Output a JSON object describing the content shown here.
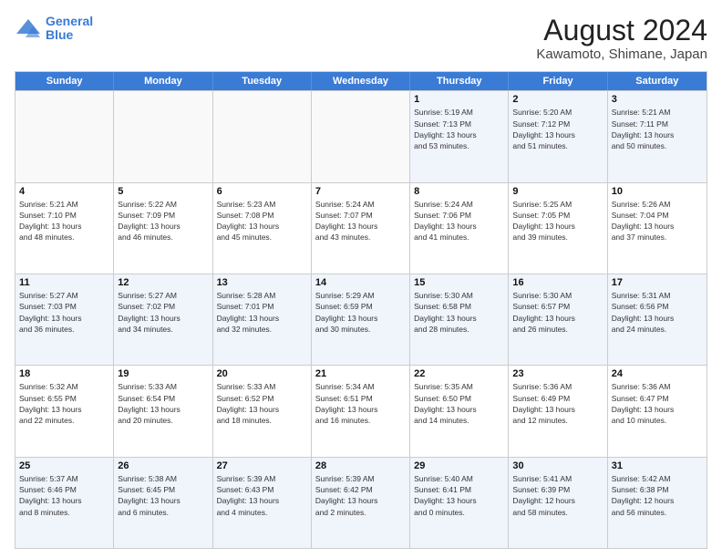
{
  "header": {
    "logo_line1": "General",
    "logo_line2": "Blue",
    "title": "August 2024",
    "subtitle": "Kawamoto, Shimane, Japan"
  },
  "weekdays": [
    "Sunday",
    "Monday",
    "Tuesday",
    "Wednesday",
    "Thursday",
    "Friday",
    "Saturday"
  ],
  "rows": [
    [
      {
        "day": "",
        "info": "",
        "empty": true
      },
      {
        "day": "",
        "info": "",
        "empty": true
      },
      {
        "day": "",
        "info": "",
        "empty": true
      },
      {
        "day": "",
        "info": "",
        "empty": true
      },
      {
        "day": "1",
        "info": "Sunrise: 5:19 AM\nSunset: 7:13 PM\nDaylight: 13 hours\nand 53 minutes."
      },
      {
        "day": "2",
        "info": "Sunrise: 5:20 AM\nSunset: 7:12 PM\nDaylight: 13 hours\nand 51 minutes."
      },
      {
        "day": "3",
        "info": "Sunrise: 5:21 AM\nSunset: 7:11 PM\nDaylight: 13 hours\nand 50 minutes."
      }
    ],
    [
      {
        "day": "4",
        "info": "Sunrise: 5:21 AM\nSunset: 7:10 PM\nDaylight: 13 hours\nand 48 minutes."
      },
      {
        "day": "5",
        "info": "Sunrise: 5:22 AM\nSunset: 7:09 PM\nDaylight: 13 hours\nand 46 minutes."
      },
      {
        "day": "6",
        "info": "Sunrise: 5:23 AM\nSunset: 7:08 PM\nDaylight: 13 hours\nand 45 minutes."
      },
      {
        "day": "7",
        "info": "Sunrise: 5:24 AM\nSunset: 7:07 PM\nDaylight: 13 hours\nand 43 minutes."
      },
      {
        "day": "8",
        "info": "Sunrise: 5:24 AM\nSunset: 7:06 PM\nDaylight: 13 hours\nand 41 minutes."
      },
      {
        "day": "9",
        "info": "Sunrise: 5:25 AM\nSunset: 7:05 PM\nDaylight: 13 hours\nand 39 minutes."
      },
      {
        "day": "10",
        "info": "Sunrise: 5:26 AM\nSunset: 7:04 PM\nDaylight: 13 hours\nand 37 minutes."
      }
    ],
    [
      {
        "day": "11",
        "info": "Sunrise: 5:27 AM\nSunset: 7:03 PM\nDaylight: 13 hours\nand 36 minutes."
      },
      {
        "day": "12",
        "info": "Sunrise: 5:27 AM\nSunset: 7:02 PM\nDaylight: 13 hours\nand 34 minutes."
      },
      {
        "day": "13",
        "info": "Sunrise: 5:28 AM\nSunset: 7:01 PM\nDaylight: 13 hours\nand 32 minutes."
      },
      {
        "day": "14",
        "info": "Sunrise: 5:29 AM\nSunset: 6:59 PM\nDaylight: 13 hours\nand 30 minutes."
      },
      {
        "day": "15",
        "info": "Sunrise: 5:30 AM\nSunset: 6:58 PM\nDaylight: 13 hours\nand 28 minutes."
      },
      {
        "day": "16",
        "info": "Sunrise: 5:30 AM\nSunset: 6:57 PM\nDaylight: 13 hours\nand 26 minutes."
      },
      {
        "day": "17",
        "info": "Sunrise: 5:31 AM\nSunset: 6:56 PM\nDaylight: 13 hours\nand 24 minutes."
      }
    ],
    [
      {
        "day": "18",
        "info": "Sunrise: 5:32 AM\nSunset: 6:55 PM\nDaylight: 13 hours\nand 22 minutes."
      },
      {
        "day": "19",
        "info": "Sunrise: 5:33 AM\nSunset: 6:54 PM\nDaylight: 13 hours\nand 20 minutes."
      },
      {
        "day": "20",
        "info": "Sunrise: 5:33 AM\nSunset: 6:52 PM\nDaylight: 13 hours\nand 18 minutes."
      },
      {
        "day": "21",
        "info": "Sunrise: 5:34 AM\nSunset: 6:51 PM\nDaylight: 13 hours\nand 16 minutes."
      },
      {
        "day": "22",
        "info": "Sunrise: 5:35 AM\nSunset: 6:50 PM\nDaylight: 13 hours\nand 14 minutes."
      },
      {
        "day": "23",
        "info": "Sunrise: 5:36 AM\nSunset: 6:49 PM\nDaylight: 13 hours\nand 12 minutes."
      },
      {
        "day": "24",
        "info": "Sunrise: 5:36 AM\nSunset: 6:47 PM\nDaylight: 13 hours\nand 10 minutes."
      }
    ],
    [
      {
        "day": "25",
        "info": "Sunrise: 5:37 AM\nSunset: 6:46 PM\nDaylight: 13 hours\nand 8 minutes."
      },
      {
        "day": "26",
        "info": "Sunrise: 5:38 AM\nSunset: 6:45 PM\nDaylight: 13 hours\nand 6 minutes."
      },
      {
        "day": "27",
        "info": "Sunrise: 5:39 AM\nSunset: 6:43 PM\nDaylight: 13 hours\nand 4 minutes."
      },
      {
        "day": "28",
        "info": "Sunrise: 5:39 AM\nSunset: 6:42 PM\nDaylight: 13 hours\nand 2 minutes."
      },
      {
        "day": "29",
        "info": "Sunrise: 5:40 AM\nSunset: 6:41 PM\nDaylight: 13 hours\nand 0 minutes."
      },
      {
        "day": "30",
        "info": "Sunrise: 5:41 AM\nSunset: 6:39 PM\nDaylight: 12 hours\nand 58 minutes."
      },
      {
        "day": "31",
        "info": "Sunrise: 5:42 AM\nSunset: 6:38 PM\nDaylight: 12 hours\nand 56 minutes."
      }
    ]
  ]
}
